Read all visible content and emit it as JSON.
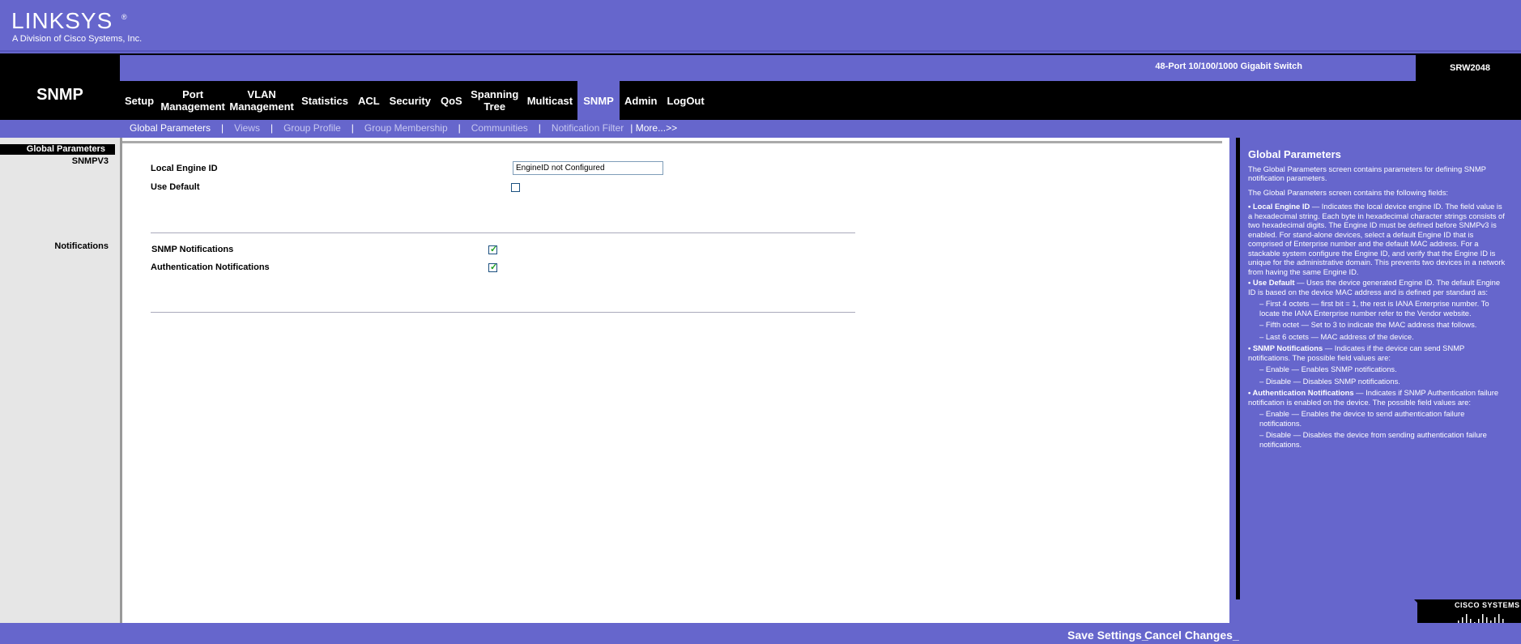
{
  "brand": {
    "logo": "LINKSYS",
    "reg": "®",
    "subtitle": "A Division of Cisco Systems, Inc."
  },
  "section_title": "SNMP",
  "model": {
    "description": "48-Port 10/100/1000 Gigabit Switch",
    "name": "SRW2048"
  },
  "main_nav": [
    {
      "label": "Setup"
    },
    {
      "label": "Port Management"
    },
    {
      "label": "VLAN Management"
    },
    {
      "label": "Statistics"
    },
    {
      "label": "ACL"
    },
    {
      "label": "Security"
    },
    {
      "label": "QoS"
    },
    {
      "label": "Spanning Tree"
    },
    {
      "label": "Multicast"
    },
    {
      "label": "SNMP",
      "active": true
    },
    {
      "label": "Admin"
    },
    {
      "label": "LogOut"
    }
  ],
  "sub_nav": {
    "items": [
      "Global Parameters",
      "Views",
      "Group Profile",
      "Group Membership",
      "Communities",
      "Notification Filter"
    ],
    "more": "| More...>>"
  },
  "sidebar": {
    "global": "Global Parameters",
    "snmpv3": "SNMPV3",
    "notifications": "Notifications"
  },
  "form": {
    "local_engine_id_label": "Local Engine ID",
    "local_engine_id_value": "EngineID not Configured",
    "use_default_label": "Use Default",
    "use_default_checked": false,
    "snmp_notifications_label": "SNMP Notifications",
    "snmp_notifications_checked": true,
    "auth_notifications_label": "Authentication Notifications",
    "auth_notifications_checked": true
  },
  "help": {
    "title": "Global Parameters",
    "intro1": "The Global Parameters screen contains parameters for defining SNMP notification parameters.",
    "intro2": "The Global Parameters screen contains the following fields:",
    "lei_term": "• Local Engine ID",
    "lei_text": " — Indicates the local device engine ID. The field value is a hexadecimal string. Each byte in hexadecimal character strings consists of two hexadecimal digits. The Engine ID must be defined before SNMPv3 is enabled. For stand-alone devices, select a default Engine ID that is comprised of Enterprise number and the default MAC address. For a stackable system configure the Engine ID, and verify that the Engine ID is unique for the administrative domain. This prevents two devices in a network from having the same Engine ID.",
    "ud_term": "• Use Default",
    "ud_text": " — Uses the device generated Engine ID. The default Engine ID is based on the device MAC address and is defined per standard as:",
    "ud_sub1": "– First 4 octets — first bit = 1, the rest is IANA Enterprise number. To locate the IANA Enterprise number refer to the Vendor website.",
    "ud_sub2": "– Fifth octet — Set to 3 to indicate the MAC address that follows.",
    "ud_sub3": "– Last 6 octets — MAC address of the device.",
    "sn_term": "• SNMP Notifications",
    "sn_text": " — Indicates if the device can send SNMP notifications. The possible field values are:",
    "sn_sub1": "– Enable — Enables SNMP notifications.",
    "sn_sub2": "– Disable — Disables SNMP notifications.",
    "an_term": "• Authentication Notifications",
    "an_text": " — Indicates if SNMP Authentication failure notification is enabled on the device. The possible field values are:",
    "an_sub1": "– Enable — Enables the device to send authentication failure notifications.",
    "an_sub2": "– Disable — Disables the device from sending authentication failure notifications."
  },
  "cisco": "CISCO SYSTEMS",
  "footer": {
    "save": "Save Settings",
    "cancel": "Cancel Changes"
  },
  "colors": {
    "brand_purple": "#6666cc",
    "band_black": "#000000"
  }
}
